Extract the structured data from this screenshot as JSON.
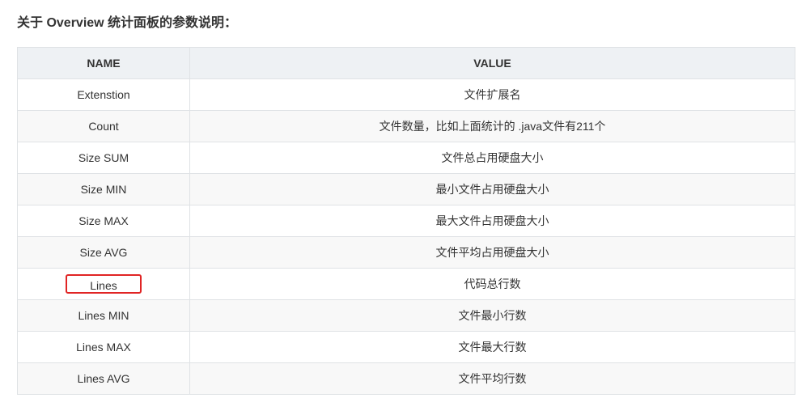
{
  "heading": "关于 Overview 统计面板的参数说明：",
  "table": {
    "headers": {
      "name": "NAME",
      "value": "VALUE"
    },
    "rows": [
      {
        "name": "Extenstion",
        "value": "文件扩展名"
      },
      {
        "name": "Count",
        "value": "文件数量，比如上面统计的 .java文件有211个"
      },
      {
        "name": "Size SUM",
        "value": "文件总占用硬盘大小"
      },
      {
        "name": "Size MIN",
        "value": "最小文件占用硬盘大小"
      },
      {
        "name": "Size MAX",
        "value": "最大文件占用硬盘大小"
      },
      {
        "name": "Size AVG",
        "value": "文件平均占用硬盘大小"
      },
      {
        "name": "Lines",
        "value": "代码总行数",
        "highlighted": true
      },
      {
        "name": "Lines MIN",
        "value": "文件最小行数"
      },
      {
        "name": "Lines MAX",
        "value": "文件最大行数"
      },
      {
        "name": "Lines AVG",
        "value": "文件平均行数"
      }
    ]
  },
  "colors": {
    "highlight_border": "#e02424",
    "header_background": "#eef1f4",
    "row_stripe": "#f8f8f8",
    "border": "#dfe2e5"
  }
}
